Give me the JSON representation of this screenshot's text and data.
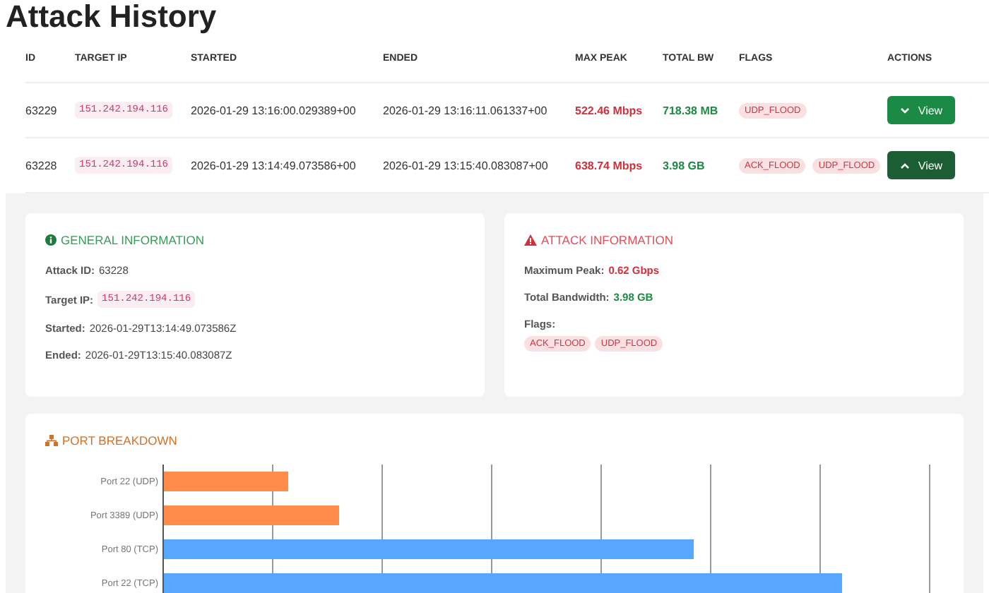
{
  "title": "Attack History",
  "table": {
    "columns": [
      "ID",
      "TARGET IP",
      "STARTED",
      "ENDED",
      "MAX PEAK",
      "TOTAL BW",
      "FLAGS",
      "ACTIONS"
    ],
    "rows": [
      {
        "id": "63229",
        "target_ip": "151.242.194.116",
        "started": "2026-01-29 13:16:00.029389+00",
        "ended": "2026-01-29 13:16:11.061337+00",
        "max_peak": "522.46 Mbps",
        "total_bw": "718.38 MB",
        "flags": [
          "UDP_FLOOD"
        ],
        "action": "View",
        "expanded": false
      },
      {
        "id": "63228",
        "target_ip": "151.242.194.116",
        "started": "2026-01-29 13:14:49.073586+00",
        "ended": "2026-01-29 13:15:40.083087+00",
        "max_peak": "638.74 Mbps",
        "total_bw": "3.98 GB",
        "flags": [
          "ACK_FLOOD",
          "UDP_FLOOD"
        ],
        "action": "View",
        "expanded": true
      }
    ]
  },
  "details": {
    "general": {
      "title": "GENERAL INFORMATION",
      "attack_id_label": "Attack ID:",
      "attack_id": "63228",
      "target_ip_label": "Target IP:",
      "target_ip": "151.242.194.116",
      "started_label": "Started:",
      "started": "2026-01-29T13:14:49.073586Z",
      "ended_label": "Ended:",
      "ended": "2026-01-29T13:15:40.083087Z"
    },
    "attack": {
      "title": "ATTACK INFORMATION",
      "max_peak_label": "Maximum Peak:",
      "max_peak": "0.62 Gbps",
      "total_bw_label": "Total Bandwidth:",
      "total_bw": "3.98 GB",
      "flags_label": "Flags:",
      "flags": [
        "ACK_FLOOD",
        "UDP_FLOOD"
      ]
    },
    "ports": {
      "title": "PORT BREAKDOWN",
      "bars": [
        {
          "label": "Port 22 (UDP)",
          "color": "#ff8c4b"
        },
        {
          "label": "Port 3389 (UDP)",
          "color": "#ff8c4b"
        },
        {
          "label": "Port 80 (TCP)",
          "color": "#57a6ff"
        },
        {
          "label": "Port 22 (TCP)",
          "color": "#57a6ff"
        }
      ]
    }
  }
}
